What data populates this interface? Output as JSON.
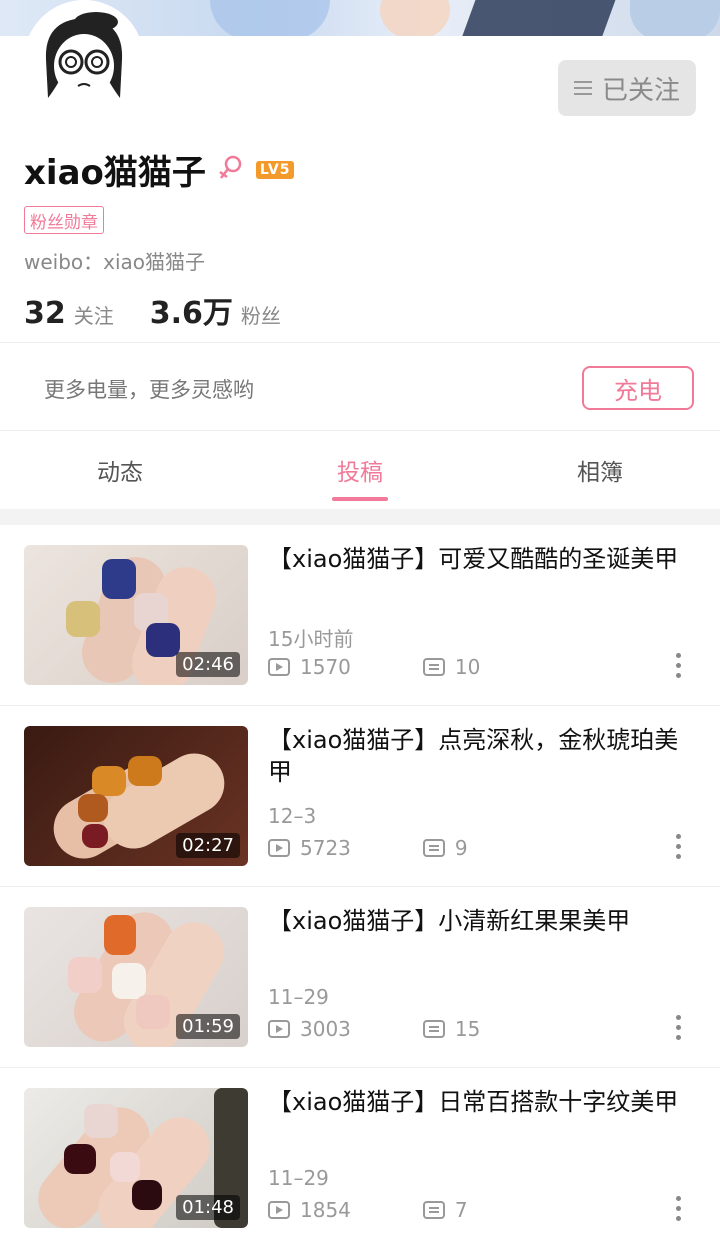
{
  "profile": {
    "username": "xiao猫猫子",
    "level": "LV5",
    "fan_badge": "粉丝勋章",
    "weibo": "weibo：xiao猫猫子",
    "following_count": "32",
    "following_label": "关注",
    "fans_count": "3.6万",
    "fans_label": "粉丝",
    "follow_button": "已关注"
  },
  "charge": {
    "text": "更多电量，更多灵感哟",
    "button": "充电"
  },
  "tabs": [
    {
      "label": "动态"
    },
    {
      "label": "投稿",
      "active": true
    },
    {
      "label": "相簿"
    }
  ],
  "videos": [
    {
      "title": "【xiao猫猫子】可爱又酷酷的圣诞美甲",
      "duration": "02:46",
      "date": "15小时前",
      "plays": "1570",
      "danmaku": "10"
    },
    {
      "title": "【xiao猫猫子】点亮深秋，金秋琥珀美甲",
      "duration": "02:27",
      "date": "12–3",
      "plays": "5723",
      "danmaku": "9"
    },
    {
      "title": "【xiao猫猫子】小清新红果果美甲",
      "duration": "01:59",
      "date": "11–29",
      "plays": "3003",
      "danmaku": "15"
    },
    {
      "title": "【xiao猫猫子】日常百搭款十字纹美甲",
      "duration": "01:48",
      "date": "11–29",
      "plays": "1854",
      "danmaku": "7"
    }
  ],
  "colors": {
    "accent": "#f07a98",
    "level_badge": "#f39a2b"
  }
}
